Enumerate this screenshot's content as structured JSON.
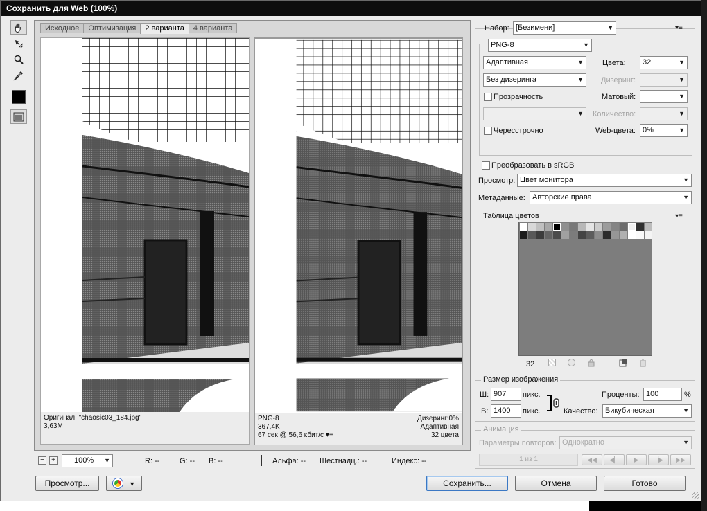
{
  "window": {
    "title": "Сохранить для Web (100%)"
  },
  "tabs": [
    {
      "label": "Исходное",
      "active": false
    },
    {
      "label": "Оптимизация",
      "active": false
    },
    {
      "label": "2 варианта",
      "active": true
    },
    {
      "label": "4 варианта",
      "active": false
    }
  ],
  "tools": [
    "hand-icon",
    "slice-select-icon",
    "zoom-icon",
    "eyedropper-icon",
    "color-swatch-icon",
    "toggle-slices-icon"
  ],
  "left_pane": {
    "original_label": "Оригинал: \"chaosic03_184.jpg\"",
    "size": "3,63M"
  },
  "right_pane": {
    "format": "PNG-8",
    "size": "367,4K",
    "download_time": "67 сек @ 56,6 кбит/с",
    "dither": "Дизеринг:0%",
    "palette": "Адаптивная",
    "colors": "32 цвета"
  },
  "status": {
    "zoom": "100%",
    "r": "R: --",
    "g": "G: --",
    "b": "B: --",
    "alpha": "Альфа: --",
    "hex": "Шестнадц.: --",
    "index": "Индекс: --"
  },
  "settings": {
    "preset_label": "Набор:",
    "preset_value": "[Безимени]",
    "format": "PNG-8",
    "reduction": "Адаптивная",
    "colors_label": "Цвета:",
    "colors_value": "32",
    "dither_algo": "Без дизеринга",
    "dither_label": "Дизеринг:",
    "transparency_label": "Прозрачность",
    "matte_label": "Матовый:",
    "amount_label": "Количество:",
    "interlaced_label": "Чересстрочно",
    "websnap_label": "Web-цвета:",
    "websnap_value": "0%",
    "convert_srgb_label": "Преобразовать в sRGB",
    "preview_label": "Просмотр:",
    "preview_value": "Цвет монитора",
    "metadata_label": "Метаданные:",
    "metadata_value": "Авторские права"
  },
  "color_table": {
    "title": "Таблица цветов",
    "count": "32"
  },
  "image_size": {
    "title": "Размер изображения",
    "w_label": "Ш:",
    "w_value": "907",
    "h_label": "В:",
    "h_value": "1400",
    "unit": "пикс.",
    "percent_label": "Проценты:",
    "percent_value": "100",
    "percent_sign": "%",
    "quality_label": "Качество:",
    "quality_value": "Бикубическая"
  },
  "animation": {
    "title": "Анимация",
    "loop_label": "Параметры повторов:",
    "loop_value": "Однократно",
    "frame": "1 из 1"
  },
  "buttons": {
    "preview": "Просмотр...",
    "save": "Сохранить...",
    "cancel": "Отмена",
    "done": "Готово"
  }
}
